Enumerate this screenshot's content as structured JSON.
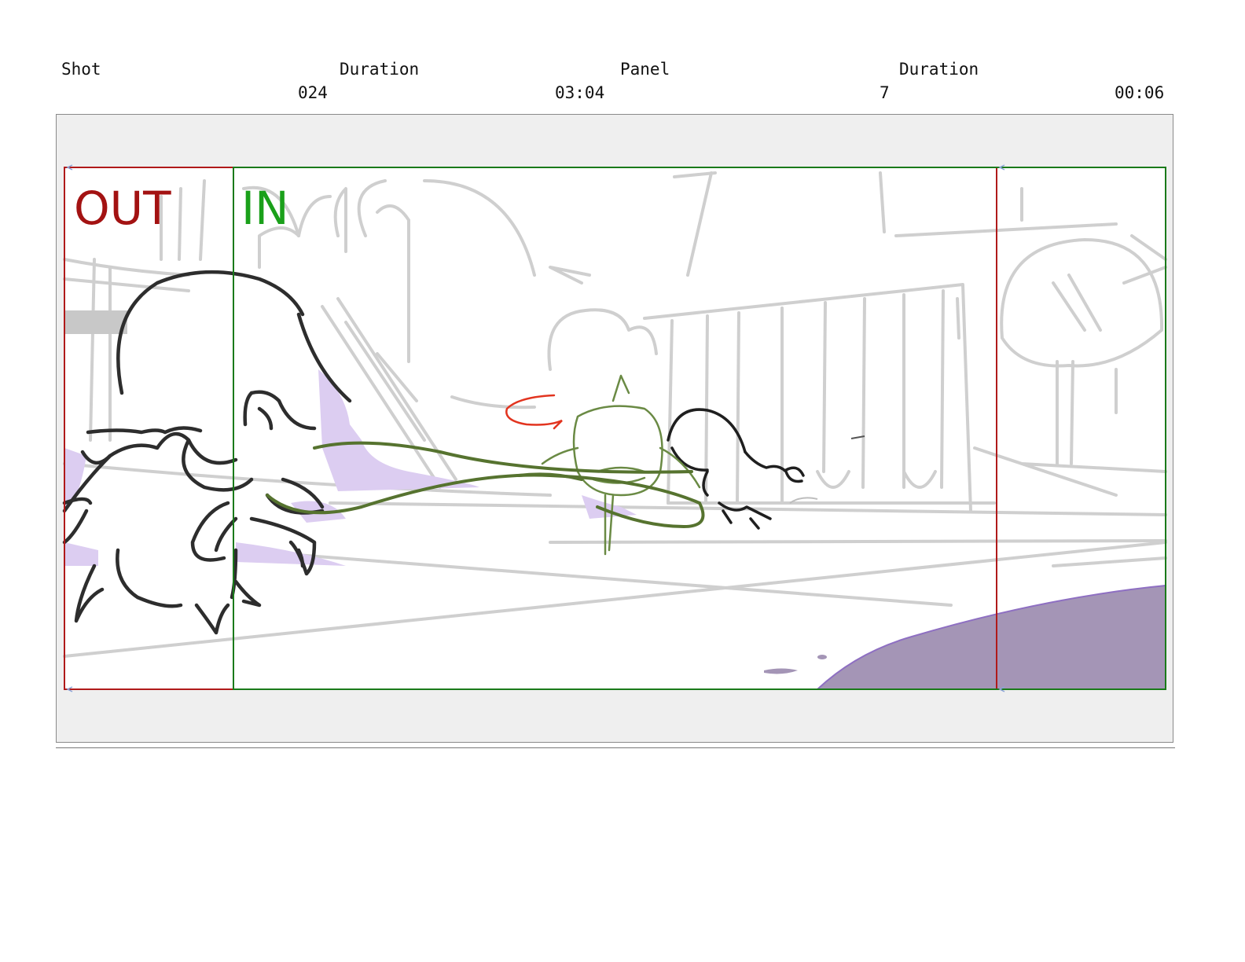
{
  "header": {
    "shot_label": "Shot",
    "shot_value": "024",
    "shot_duration_label": "Duration",
    "shot_duration_value": "03:04",
    "panel_label": "Panel",
    "panel_value": "7",
    "panel_duration_label": "Duration",
    "panel_duration_value": "00:06"
  },
  "panel": {
    "out_label": "OUT",
    "in_label": "IN"
  },
  "colors": {
    "out_frame": "#b01a1a",
    "in_frame": "#1a7a1a",
    "out_text": "#a31212",
    "in_text": "#1aa01a",
    "character_line": "#2a2a2a",
    "background_sketch": "#c8c8c8",
    "motion_line": "#5a7a32",
    "shadow_purple": "#a493b5",
    "highlight_purple": "#d7c7ee",
    "red_sketch": "#e0321e"
  }
}
